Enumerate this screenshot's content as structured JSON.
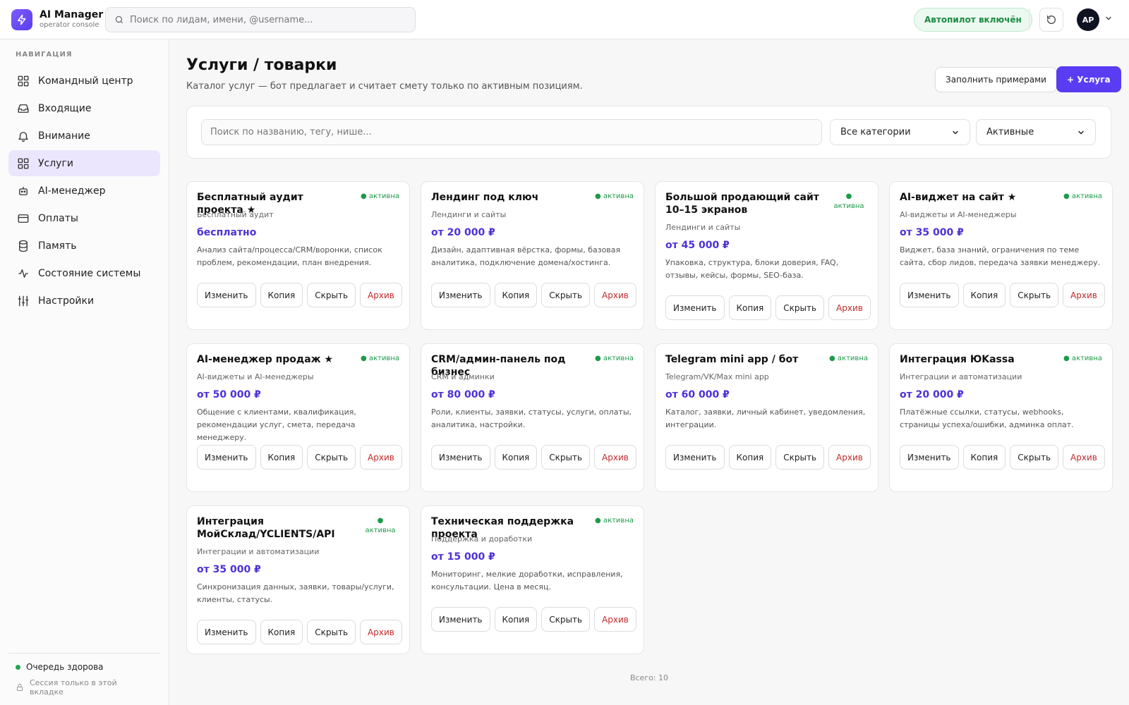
{
  "app": {
    "title": "AI Manager",
    "subtitle": "operator console",
    "brand_color": "#5a3df2"
  },
  "topbar": {
    "search_placeholder": "Поиск по лидам, имени, @username...",
    "autopilot": "Автопилот включён",
    "avatar_initials": "AP"
  },
  "sidebar": {
    "caption": "НАВИГАЦИЯ",
    "items": [
      {
        "label": "Командный центр",
        "icon": "grid-icon",
        "active": false
      },
      {
        "label": "Входящие",
        "icon": "inbox-icon",
        "active": false
      },
      {
        "label": "Внимание",
        "icon": "bell-icon",
        "active": false
      },
      {
        "label": "Услуги",
        "icon": "grid-icon",
        "active": true
      },
      {
        "label": "AI-менеджер",
        "icon": "robot-icon",
        "active": false
      },
      {
        "label": "Оплаты",
        "icon": "card-icon",
        "active": false
      },
      {
        "label": "Память",
        "icon": "database-icon",
        "active": false
      },
      {
        "label": "Состояние системы",
        "icon": "activity-icon",
        "active": false
      },
      {
        "label": "Настройки",
        "icon": "sliders-icon",
        "active": false
      }
    ],
    "queue_status": "Очередь здорова",
    "session_note": "Сессия только в этой вкладке"
  },
  "page": {
    "title": "Услуги / товарки",
    "subtitle": "Каталог услуг — бот предлагает и считает смету только по активным позициям.",
    "fill_button": "Заполнить примерами",
    "add_button": "+ Услуга"
  },
  "filters": {
    "search_placeholder": "Поиск по названию, тегу, нише...",
    "category": "Все категории",
    "status": "Активные"
  },
  "card_actions": {
    "edit": "Изменить",
    "copy": "Копия",
    "hide": "Скрыть",
    "archive": "Архив"
  },
  "services": [
    {
      "title": "Бесплатный аудит проекта ★",
      "status": "● активна",
      "category": "Бесплатный аудит",
      "price": "бесплатно",
      "description": "Анализ сайта/процесса/CRM/воронки, список проблем, рекомендации, план внедрения."
    },
    {
      "title": "Лендинг под ключ",
      "status": "● активна",
      "category": "Лендинги и сайты",
      "price": "от 20 000 ₽",
      "description": "Дизайн, адаптивная вёрстка, формы, базовая аналитика, подключение домена/хостинга."
    },
    {
      "title": "Большой продающий сайт 10–15 экранов",
      "status": "● активна",
      "category": "Лендинги и сайты",
      "price": "от 45 000 ₽",
      "description": "Упаковка, структура, блоки доверия, FAQ, отзывы, кейсы, формы, SEO-база."
    },
    {
      "title": "AI-виджет на сайт ★",
      "status": "● активна",
      "category": "AI-виджеты и AI-менеджеры",
      "price": "от 35 000 ₽",
      "description": "Виджет, база знаний, ограничения по теме сайта, сбор лидов, передача заявки менеджеру."
    },
    {
      "title": "AI-менеджер продаж ★",
      "status": "● активна",
      "category": "AI-виджеты и AI-менеджеры",
      "price": "от 50 000 ₽",
      "description": "Общение с клиентами, квалификация, рекомендации услуг, смета, передача менеджеру."
    },
    {
      "title": "CRM/админ-панель под бизнес",
      "status": "● активна",
      "category": "CRM и админки",
      "price": "от 80 000 ₽",
      "description": "Роли, клиенты, заявки, статусы, услуги, оплаты, аналитика, настройки."
    },
    {
      "title": "Telegram mini app / бот",
      "status": "● активна",
      "category": "Telegram/VK/Max mini app",
      "price": "от 60 000 ₽",
      "description": "Каталог, заявки, личный кабинет, уведомления, интеграции."
    },
    {
      "title": "Интеграция ЮKassa",
      "status": "● активна",
      "category": "Интеграции и автоматизации",
      "price": "от 20 000 ₽",
      "description": "Платёжные ссылки, статусы, webhooks, страницы успеха/ошибки, админка оплат."
    },
    {
      "title": "Интеграция МойСклад/YCLIENTS/API",
      "status": "● активна",
      "category": "Интеграции и автоматизации",
      "price": "от 35 000 ₽",
      "description": "Синхронизация данных, заявки, товары/услуги, клиенты, статусы."
    },
    {
      "title": "Техническая поддержка проекта",
      "status": "● активна",
      "category": "Поддержка и доработки",
      "price": "от 15 000 ₽",
      "description": "Мониторинг, мелкие доработки, исправления, консультации. Цена в месяц."
    }
  ],
  "total": "Всего: 10"
}
